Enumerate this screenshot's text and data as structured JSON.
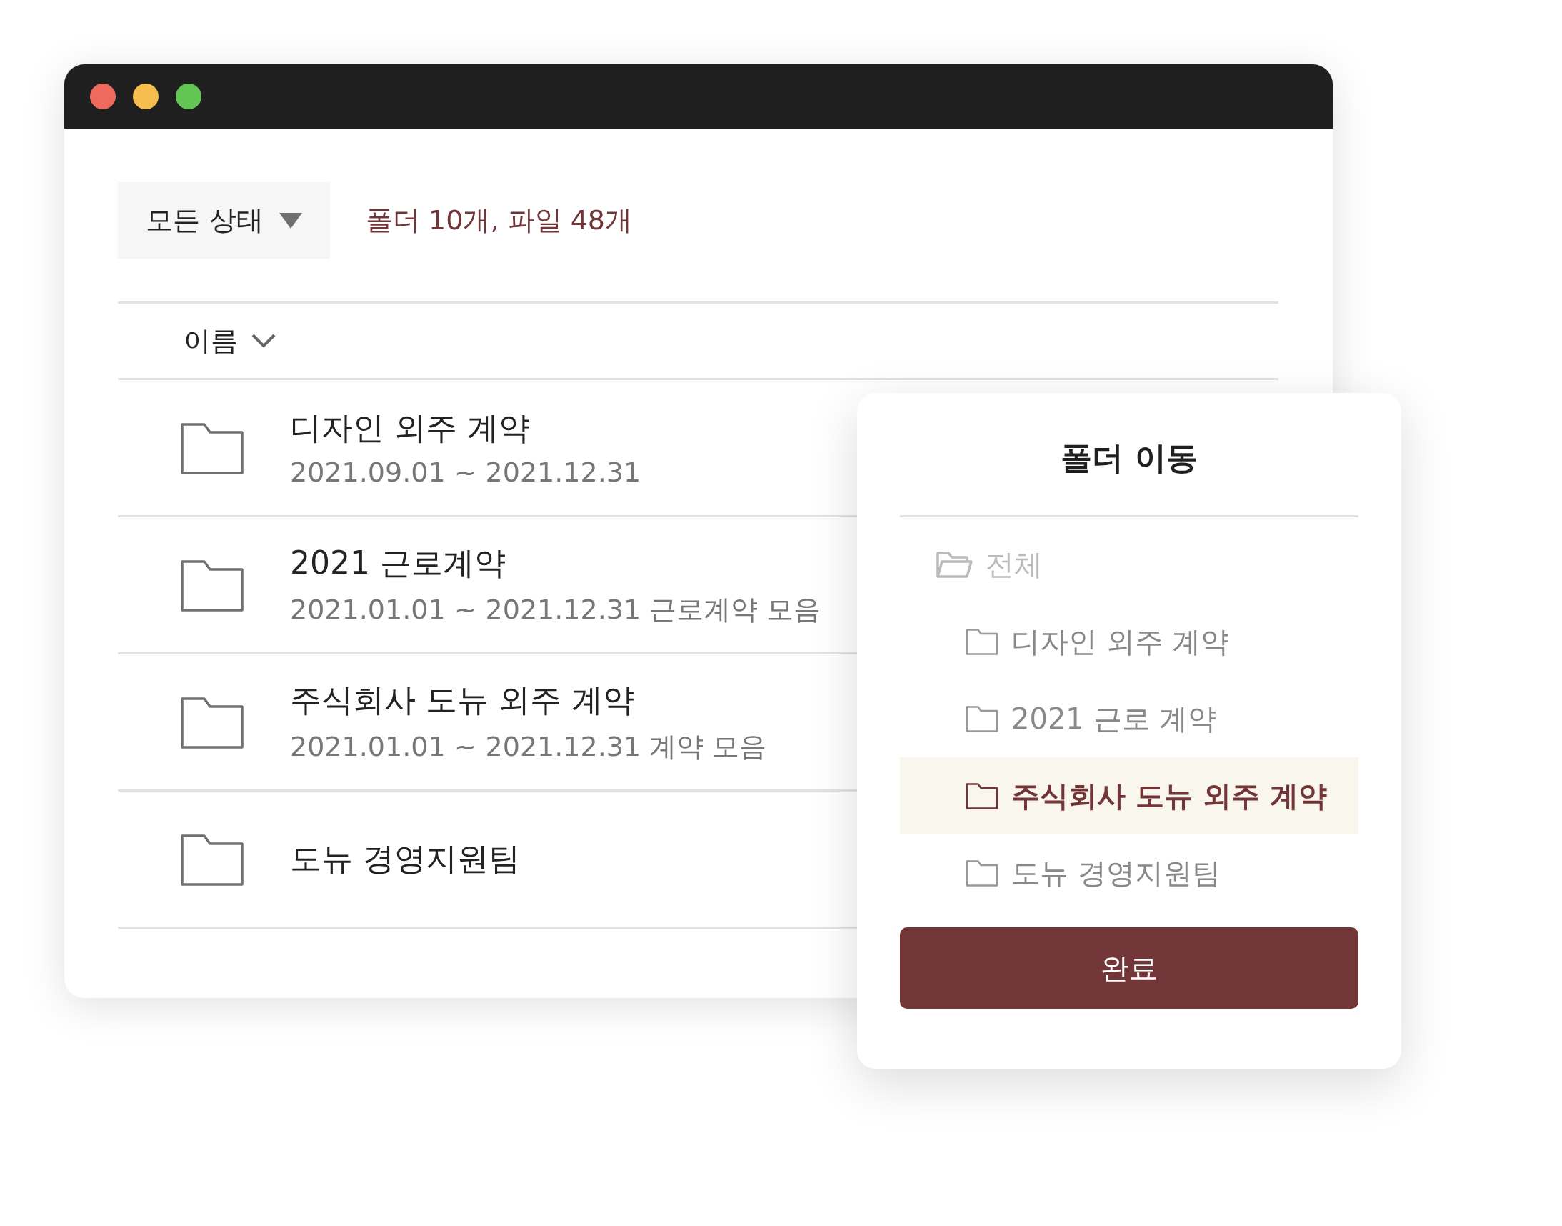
{
  "filter": {
    "label": "모든 상태",
    "summary": "폴더 10개, 파일 48개"
  },
  "sort": {
    "label": "이름"
  },
  "items": [
    {
      "name": "디자인 외주 계약",
      "detail": "2021.09.01 ~ 2021.12.31"
    },
    {
      "name": "2021 근로계약",
      "detail": "2021.01.01 ~ 2021.12.31 근로계약 모음"
    },
    {
      "name": "주식회사 도뉴 외주 계약",
      "detail": "2021.01.01 ~ 2021.12.31 계약 모음"
    },
    {
      "name": "도뉴 경영지원팀"
    }
  ],
  "dialog": {
    "title": "폴더 이동",
    "tree": {
      "label": "전체",
      "disabled": true,
      "selected": false,
      "children": [
        {
          "label": "디자인 외주 계약",
          "selected": false
        },
        {
          "label": "2021 근로 계약",
          "selected": false
        },
        {
          "label": "주식회사 도뉴 외주 계약",
          "selected": true
        },
        {
          "label": "도뉴 경영지원팀",
          "selected": false
        }
      ]
    },
    "button": "완료"
  }
}
